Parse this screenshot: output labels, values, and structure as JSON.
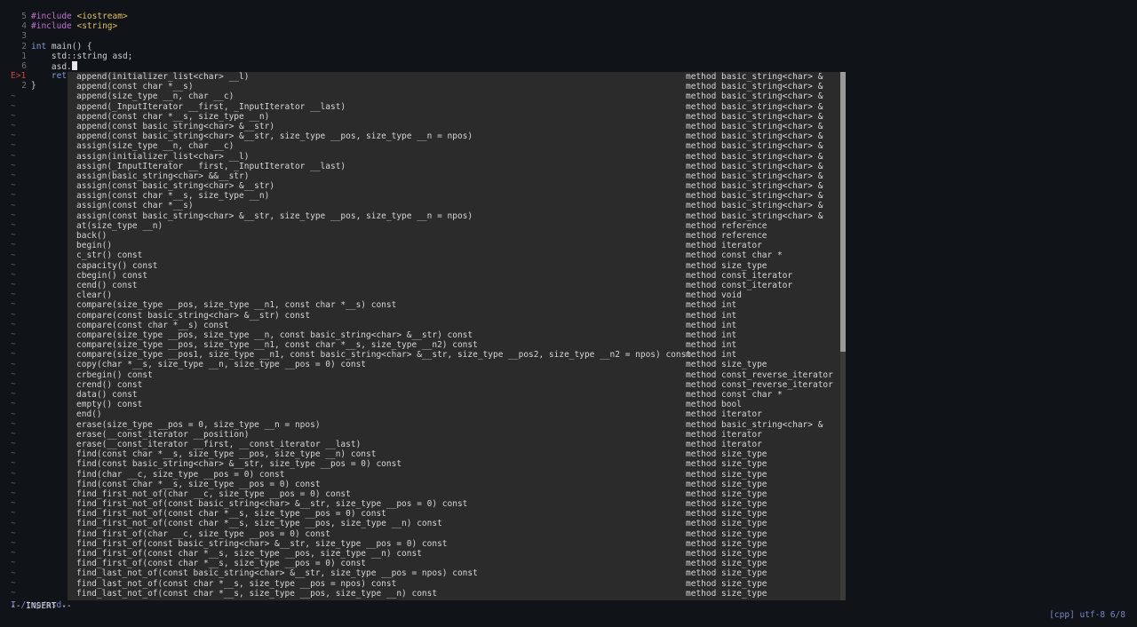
{
  "editor": {
    "lines": [
      {
        "num": "5",
        "parts": [
          [
            "pre",
            "#include "
          ],
          [
            "inc",
            "<iostream>"
          ]
        ]
      },
      {
        "num": "4",
        "parts": [
          [
            "pre",
            "#include "
          ],
          [
            "inc",
            "<string>"
          ]
        ]
      },
      {
        "num": "3",
        "parts": []
      },
      {
        "num": "2",
        "parts": [
          [
            "kw",
            "int"
          ],
          [
            "plain",
            " main() {"
          ]
        ]
      },
      {
        "num": "1",
        "parts": [
          [
            "plain",
            "    std::string asd;"
          ]
        ]
      },
      {
        "num": "6",
        "parts": [
          [
            "plain",
            "    asd."
          ]
        ],
        "cursor": true
      },
      {
        "num": "E>1",
        "parts": [
          [
            "kw",
            "    ret"
          ]
        ],
        "sign": true
      },
      {
        "num": "2",
        "parts": [
          [
            "plain",
            "}"
          ]
        ]
      }
    ],
    "tilde_char": "~",
    "tilde_count": 52
  },
  "popup": {
    "items": [
      {
        "word": "append(initializer_list<char> __l)",
        "kind": "method basic_string<char> &"
      },
      {
        "word": "append(const char *__s)",
        "kind": "method basic_string<char> &"
      },
      {
        "word": "append(size_type __n, char __c)",
        "kind": "method basic_string<char> &"
      },
      {
        "word": "append(_InputIterator __first, _InputIterator __last)",
        "kind": "method basic_string<char> &"
      },
      {
        "word": "append(const char *__s, size_type __n)",
        "kind": "method basic_string<char> &"
      },
      {
        "word": "append(const basic_string<char> &__str)",
        "kind": "method basic_string<char> &"
      },
      {
        "word": "append(const basic_string<char> &__str, size_type __pos, size_type __n = npos)",
        "kind": "method basic_string<char> &"
      },
      {
        "word": "assign(size_type __n, char __c)",
        "kind": "method basic_string<char> &"
      },
      {
        "word": "assign(initializer_list<char> __l)",
        "kind": "method basic_string<char> &"
      },
      {
        "word": "assign(_InputIterator __first, _InputIterator __last)",
        "kind": "method basic_string<char> &"
      },
      {
        "word": "assign(basic_string<char> &&__str)",
        "kind": "method basic_string<char> &"
      },
      {
        "word": "assign(const basic_string<char> &__str)",
        "kind": "method basic_string<char> &"
      },
      {
        "word": "assign(const char *__s, size_type __n)",
        "kind": "method basic_string<char> &"
      },
      {
        "word": "assign(const char *__s)",
        "kind": "method basic_string<char> &"
      },
      {
        "word": "assign(const basic_string<char> &__str, size_type __pos, size_type __n = npos)",
        "kind": "method basic_string<char> &"
      },
      {
        "word": "at(size_type __n)",
        "kind": "method reference"
      },
      {
        "word": "back()",
        "kind": "method reference"
      },
      {
        "word": "begin()",
        "kind": "method iterator"
      },
      {
        "word": "c_str() const",
        "kind": "method const char *"
      },
      {
        "word": "capacity() const",
        "kind": "method size_type"
      },
      {
        "word": "cbegin() const",
        "kind": "method const_iterator"
      },
      {
        "word": "cend() const",
        "kind": "method const_iterator"
      },
      {
        "word": "clear()",
        "kind": "method void"
      },
      {
        "word": "compare(size_type __pos, size_type __n1, const char *__s) const",
        "kind": "method int"
      },
      {
        "word": "compare(const basic_string<char> &__str) const",
        "kind": "method int"
      },
      {
        "word": "compare(const char *__s) const",
        "kind": "method int"
      },
      {
        "word": "compare(size_type __pos, size_type __n, const basic_string<char> &__str) const",
        "kind": "method int"
      },
      {
        "word": "compare(size_type __pos, size_type __n1, const char *__s, size_type __n2) const",
        "kind": "method int"
      },
      {
        "word": "compare(size_type __pos1, size_type __n1, const basic_string<char> &__str, size_type __pos2, size_type __n2 = npos) const",
        "kind": "method int"
      },
      {
        "word": "copy(char *__s, size_type __n, size_type __pos = 0) const",
        "kind": "method size_type"
      },
      {
        "word": "crbegin() const",
        "kind": "method const_reverse_iterator"
      },
      {
        "word": "crend() const",
        "kind": "method const_reverse_iterator"
      },
      {
        "word": "data() const",
        "kind": "method const char *"
      },
      {
        "word": "empty() const",
        "kind": "method bool"
      },
      {
        "word": "end()",
        "kind": "method iterator"
      },
      {
        "word": "erase(size_type __pos = 0, size_type __n = npos)",
        "kind": "method basic_string<char> &"
      },
      {
        "word": "erase(__const_iterator __position)",
        "kind": "method iterator"
      },
      {
        "word": "erase(__const_iterator __first, __const_iterator __last)",
        "kind": "method iterator"
      },
      {
        "word": "find(const char *__s, size_type __pos, size_type __n) const",
        "kind": "method size_type"
      },
      {
        "word": "find(const basic_string<char> &__str, size_type __pos = 0) const",
        "kind": "method size_type"
      },
      {
        "word": "find(char __c, size_type __pos = 0) const",
        "kind": "method size_type"
      },
      {
        "word": "find(const char *__s, size_type __pos = 0) const",
        "kind": "method size_type"
      },
      {
        "word": "find_first_not_of(char __c, size_type __pos = 0) const",
        "kind": "method size_type"
      },
      {
        "word": "find_first_not_of(const basic_string<char> &__str, size_type __pos = 0) const",
        "kind": "method size_type"
      },
      {
        "word": "find_first_not_of(const char *__s, size_type __pos = 0) const",
        "kind": "method size_type"
      },
      {
        "word": "find_first_not_of(const char *__s, size_type __pos, size_type __n) const",
        "kind": "method size_type"
      },
      {
        "word": "find_first_of(char __c, size_type __pos = 0) const",
        "kind": "method size_type"
      },
      {
        "word": "find_first_of(const basic_string<char> &__str, size_type __pos = 0) const",
        "kind": "method size_type"
      },
      {
        "word": "find_first_of(const char *__s, size_type __pos, size_type __n) const",
        "kind": "method size_type"
      },
      {
        "word": "find_first_of(const char *__s, size_type __pos = 0) const",
        "kind": "method size_type"
      },
      {
        "word": "find_last_not_of(const basic_string<char> &__str, size_type __pos = npos) const",
        "kind": "method size_type"
      },
      {
        "word": "find_last_not_of(const char *__s, size_type __pos = npos) const",
        "kind": "method size_type"
      },
      {
        "word": "find_last_not_of(const char *__s, size_type __pos, size_type __n) const",
        "kind": "method size_type"
      }
    ],
    "scroll_fraction_visible": 0.53
  },
  "statusline": {
    "left": "I /tmp/asd.",
    "right": "[cpp] utf-8 6/8"
  },
  "modeline": "-- INSERT --",
  "colors": {
    "background": "#101318",
    "popup_bg": "#2b2b2b",
    "preproc": "#c26fd3",
    "include_path": "#e0c060",
    "keyword": "#7e9cd8",
    "error_sign": "#d04040",
    "status": "#7a86c8"
  }
}
